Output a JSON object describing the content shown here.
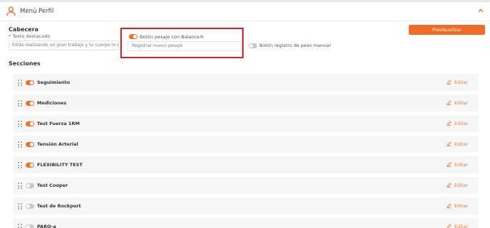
{
  "header": {
    "title": "Menú Perfil",
    "icon": "user-icon",
    "collapse_icon": "chevron-up-icon"
  },
  "cabecera": {
    "title": "Cabecera",
    "featured_text_label": "* Texto destacado",
    "featured_text_value": "Estás realizando un gran trabajo y tu cuerpo lo está",
    "balance_toggle_label": "Botón pesaje con Balance®",
    "balance_toggle_on": true,
    "balance_input_value": "Registrar nuevo pesaje",
    "manual_toggle_label": "Botón registro de peso manual",
    "manual_toggle_on": false,
    "preview_button": "Previsualizar"
  },
  "secciones": {
    "title": "Secciones",
    "edit_label": "Editar",
    "items": [
      {
        "label": "Seguimiento",
        "on": true
      },
      {
        "label": "Mediciones",
        "on": true
      },
      {
        "label": "Test Fuerza 1RM",
        "on": true
      },
      {
        "label": "Tensión Arterial",
        "on": true
      },
      {
        "label": "FLEXIBILITY TEST",
        "on": true
      },
      {
        "label": "Test Cooper",
        "on": false
      },
      {
        "label": "Test de Rockport",
        "on": false
      },
      {
        "label": "PARQ-a",
        "on": false
      }
    ]
  },
  "colors": {
    "accent": "#f06b25",
    "highlight": "#e11d25",
    "toggle_off": "#c8c8c8",
    "row_bg": "#f6f6f6"
  }
}
